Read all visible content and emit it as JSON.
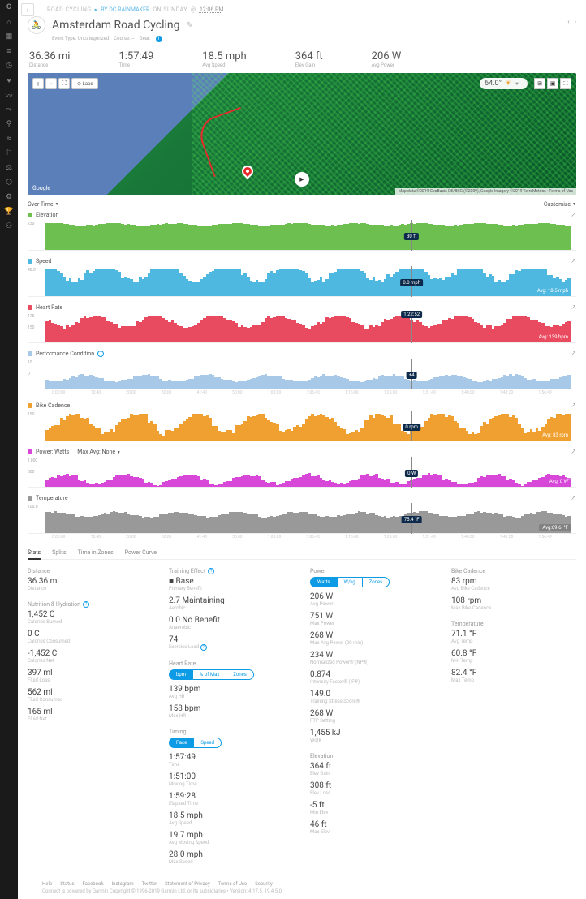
{
  "logo": "C",
  "expand": "›",
  "breadcrumb": {
    "primary": "ROAD CYCLING",
    "sep": "▸",
    "source": "BY DC RAINMAKER",
    "when": "ON SUNDAY",
    "at": "@",
    "time": "12:06 PM"
  },
  "title": "Amsterdam Road Cycling",
  "title_edit": "✎",
  "title_sub": {
    "a": "Event Type: Uncategorized",
    "b": "Course: --",
    "c": "Gear:"
  },
  "summary": [
    {
      "v": "36.36 mi",
      "l": "Distance"
    },
    {
      "v": "1:57:49",
      "l": "Time"
    },
    {
      "v": "18.5 mph",
      "l": "Avg Speed"
    },
    {
      "v": "364 ft",
      "l": "Elev Gain"
    },
    {
      "v": "206 W",
      "l": "Avg Power"
    }
  ],
  "map": {
    "zoom_in": "+",
    "zoom_out": "−",
    "full": "⛶",
    "laps": "⊙ Laps",
    "google": "Google",
    "temp": "64.0°",
    "sun": "☀",
    "play": "▶",
    "attrib": "Map data ©2019 GeoBasis-DE/BKG (©2009), Google Imagery ©2019 TerraMetrics · Terms of Use"
  },
  "tabbar": {
    "overtime": "Over Time",
    "customize": "Customize"
  },
  "charts": {
    "elev": {
      "name": "Elevation",
      "y": "230",
      "cursor": "30 ft",
      "color": "#6dc04f"
    },
    "speed": {
      "name": "Speed",
      "y": "40.0",
      "cursor": "0.0 mph",
      "badge": "Avg: 18.5 mph",
      "color": "#4fb8e0"
    },
    "hr": {
      "name": "Heart Rate",
      "y": "175",
      "y2": "150",
      "cursor": "1:22:52",
      "badge": "Avg: 139 bpm",
      "color": "#e84a5f"
    },
    "pc": {
      "name": "Performance Condition",
      "y": "10",
      "y2": "0",
      "cursor": "+4",
      "color": "#a8c8e8"
    },
    "cad": {
      "name": "Bike Cadence",
      "y": "150",
      "cursor": "0 rpm",
      "badge": "Avg: 83 rpm",
      "color": "#f0a030"
    },
    "pw": {
      "name": "Power: Watts",
      "extra": "Max Avg: None",
      "y": "1,000",
      "y2": "500",
      "cursor": "0 W",
      "badge": "Avg: 0 W",
      "color": "#d848d8"
    },
    "temp": {
      "name": "Temperature",
      "y": "100.0",
      "cursor": "75.4 °F",
      "badge": "Avg:69.6: °F",
      "color": "#999"
    },
    "xticks": [
      "0:00:00",
      "10:40",
      "20:00",
      "30:00",
      "41:40",
      "50:00",
      "1:00:00",
      "1:06:40",
      "1:15:00",
      "1:25:00",
      "1:31:40",
      "1:40:00",
      "1:48:20",
      "1:56:40"
    ]
  },
  "stats_tabs": [
    "Stats",
    "Splits",
    "Time in Zones",
    "Power Curve"
  ],
  "stats": {
    "c1": [
      {
        "h": "Distance",
        "items": [
          {
            "v": "36.36 mi",
            "l": "Distance"
          }
        ]
      },
      {
        "h": "Nutrition & Hydration",
        "q": true,
        "items": [
          {
            "v": "1,452 C",
            "l": "Calories Burned"
          },
          {
            "v": "0 C",
            "l": "Calories Consumed"
          },
          {
            "v": "-1,452 C",
            "l": "Calories Net"
          },
          {
            "v": "397 ml",
            "l": "Fluid Loss"
          },
          {
            "v": "562 ml",
            "l": "Fluid Consumed"
          },
          {
            "v": "165 ml",
            "l": "Fluid Net"
          }
        ]
      }
    ],
    "c2": [
      {
        "h": "Training Effect",
        "q": true,
        "items": [
          {
            "v": "■ Base",
            "l": "Primary Benefit"
          },
          {
            "v": "2.7 Maintaining",
            "l": "Aerobic"
          },
          {
            "v": "0.0 No Benefit",
            "l": "Anaerobic"
          },
          {
            "v": "74",
            "l": "Exercise Load",
            "q": true
          }
        ]
      },
      {
        "h": "Heart Rate",
        "pills": [
          "bpm",
          "% of Max",
          "Zones"
        ],
        "items": [
          {
            "v": "139 bpm",
            "l": "Avg HR"
          },
          {
            "v": "158 bpm",
            "l": "Max HR"
          }
        ]
      },
      {
        "h": "Timing",
        "pills": [
          "Pace",
          "Speed"
        ],
        "items": [
          {
            "v": "1:57:49",
            "l": "Time"
          },
          {
            "v": "1:51:00",
            "l": "Moving Time"
          },
          {
            "v": "1:59:28",
            "l": "Elapsed Time"
          },
          {
            "v": "18.5 mph",
            "l": "Avg Speed"
          },
          {
            "v": "19.7 mph",
            "l": "Avg Moving Speed"
          },
          {
            "v": "28.0 mph",
            "l": "Max Speed"
          }
        ]
      }
    ],
    "c3": [
      {
        "h": "Power",
        "pills": [
          "Watts",
          "W/kg",
          "Zones"
        ],
        "items": [
          {
            "v": "206 W",
            "l": "Avg Power"
          },
          {
            "v": "751 W",
            "l": "Max Power"
          },
          {
            "v": "268 W",
            "l": "Max Avg Power (20 min)"
          },
          {
            "v": "234 W",
            "l": "Normalized Power® (NP®)"
          },
          {
            "v": "0.874",
            "l": "Intensity Factor® (IF®)"
          },
          {
            "v": "149.0",
            "l": "Training Stress Score®"
          },
          {
            "v": "268 W",
            "l": "FTP Setting"
          },
          {
            "v": "1,455 kJ",
            "l": "Work"
          }
        ]
      },
      {
        "h": "Elevation",
        "items": [
          {
            "v": "364 ft",
            "l": "Elev Gain"
          },
          {
            "v": "308 ft",
            "l": "Elev Loss"
          },
          {
            "v": "-5 ft",
            "l": "Min Elev"
          },
          {
            "v": "46 ft",
            "l": "Max Elev"
          }
        ]
      }
    ],
    "c4": [
      {
        "h": "Bike Cadence",
        "items": [
          {
            "v": "83 rpm",
            "l": "Avg Bike Cadence"
          },
          {
            "v": "108 rpm",
            "l": "Max Bike Cadence"
          }
        ]
      },
      {
        "h": "Temperature",
        "items": [
          {
            "v": "71.1 °F",
            "l": "Avg Temp"
          },
          {
            "v": "60.8 °F",
            "l": "Min Temp"
          },
          {
            "v": "82.4 °F",
            "l": "Max Temp"
          }
        ]
      }
    ]
  },
  "footer": {
    "links": [
      "Help",
      "Status",
      "Facebook",
      "Instagram",
      "Twitter",
      "Statement of Privacy",
      "Terms of Use",
      "Security"
    ],
    "copy": "Connect is powered by Garmin       Copyright © 1996-2019 Garmin Ltd. or its subsidiaries • Version: 4.17.5, 19.4.5.0"
  },
  "chart_data": [
    {
      "type": "area",
      "title": "Elevation",
      "ylim": [
        0,
        230
      ],
      "y_unit": "ft",
      "values_approx": "flat ~30 ft across full ride",
      "x_unit": "time",
      "x_range": [
        "0:00:00",
        "1:57:49"
      ]
    },
    {
      "type": "area",
      "title": "Speed",
      "ylim": [
        0,
        40
      ],
      "y_unit": "mph",
      "avg": 18.5,
      "x_range": [
        "0:00:00",
        "1:57:49"
      ]
    },
    {
      "type": "area",
      "title": "Heart Rate",
      "ylim": [
        0,
        175
      ],
      "y_unit": "bpm",
      "avg": 139,
      "x_range": [
        "0:00:00",
        "1:57:49"
      ]
    },
    {
      "type": "area",
      "title": "Performance Condition",
      "ylim": [
        0,
        10
      ],
      "cursor_value": 4,
      "x_range": [
        "0:00:00",
        "1:57:49"
      ]
    },
    {
      "type": "area",
      "title": "Bike Cadence",
      "ylim": [
        0,
        150
      ],
      "y_unit": "rpm",
      "avg": 83,
      "x_range": [
        "0:00:00",
        "1:57:49"
      ]
    },
    {
      "type": "area",
      "title": "Power: Watts",
      "ylim": [
        0,
        1000
      ],
      "y_unit": "W",
      "cursor_value": 0,
      "x_range": [
        "0:00:00",
        "1:57:49"
      ]
    },
    {
      "type": "area",
      "title": "Temperature",
      "ylim": [
        0,
        100
      ],
      "y_unit": "°F",
      "avg": 69.6,
      "cursor_value": 75.4,
      "x_range": [
        "0:00:00",
        "1:57:49"
      ]
    }
  ]
}
